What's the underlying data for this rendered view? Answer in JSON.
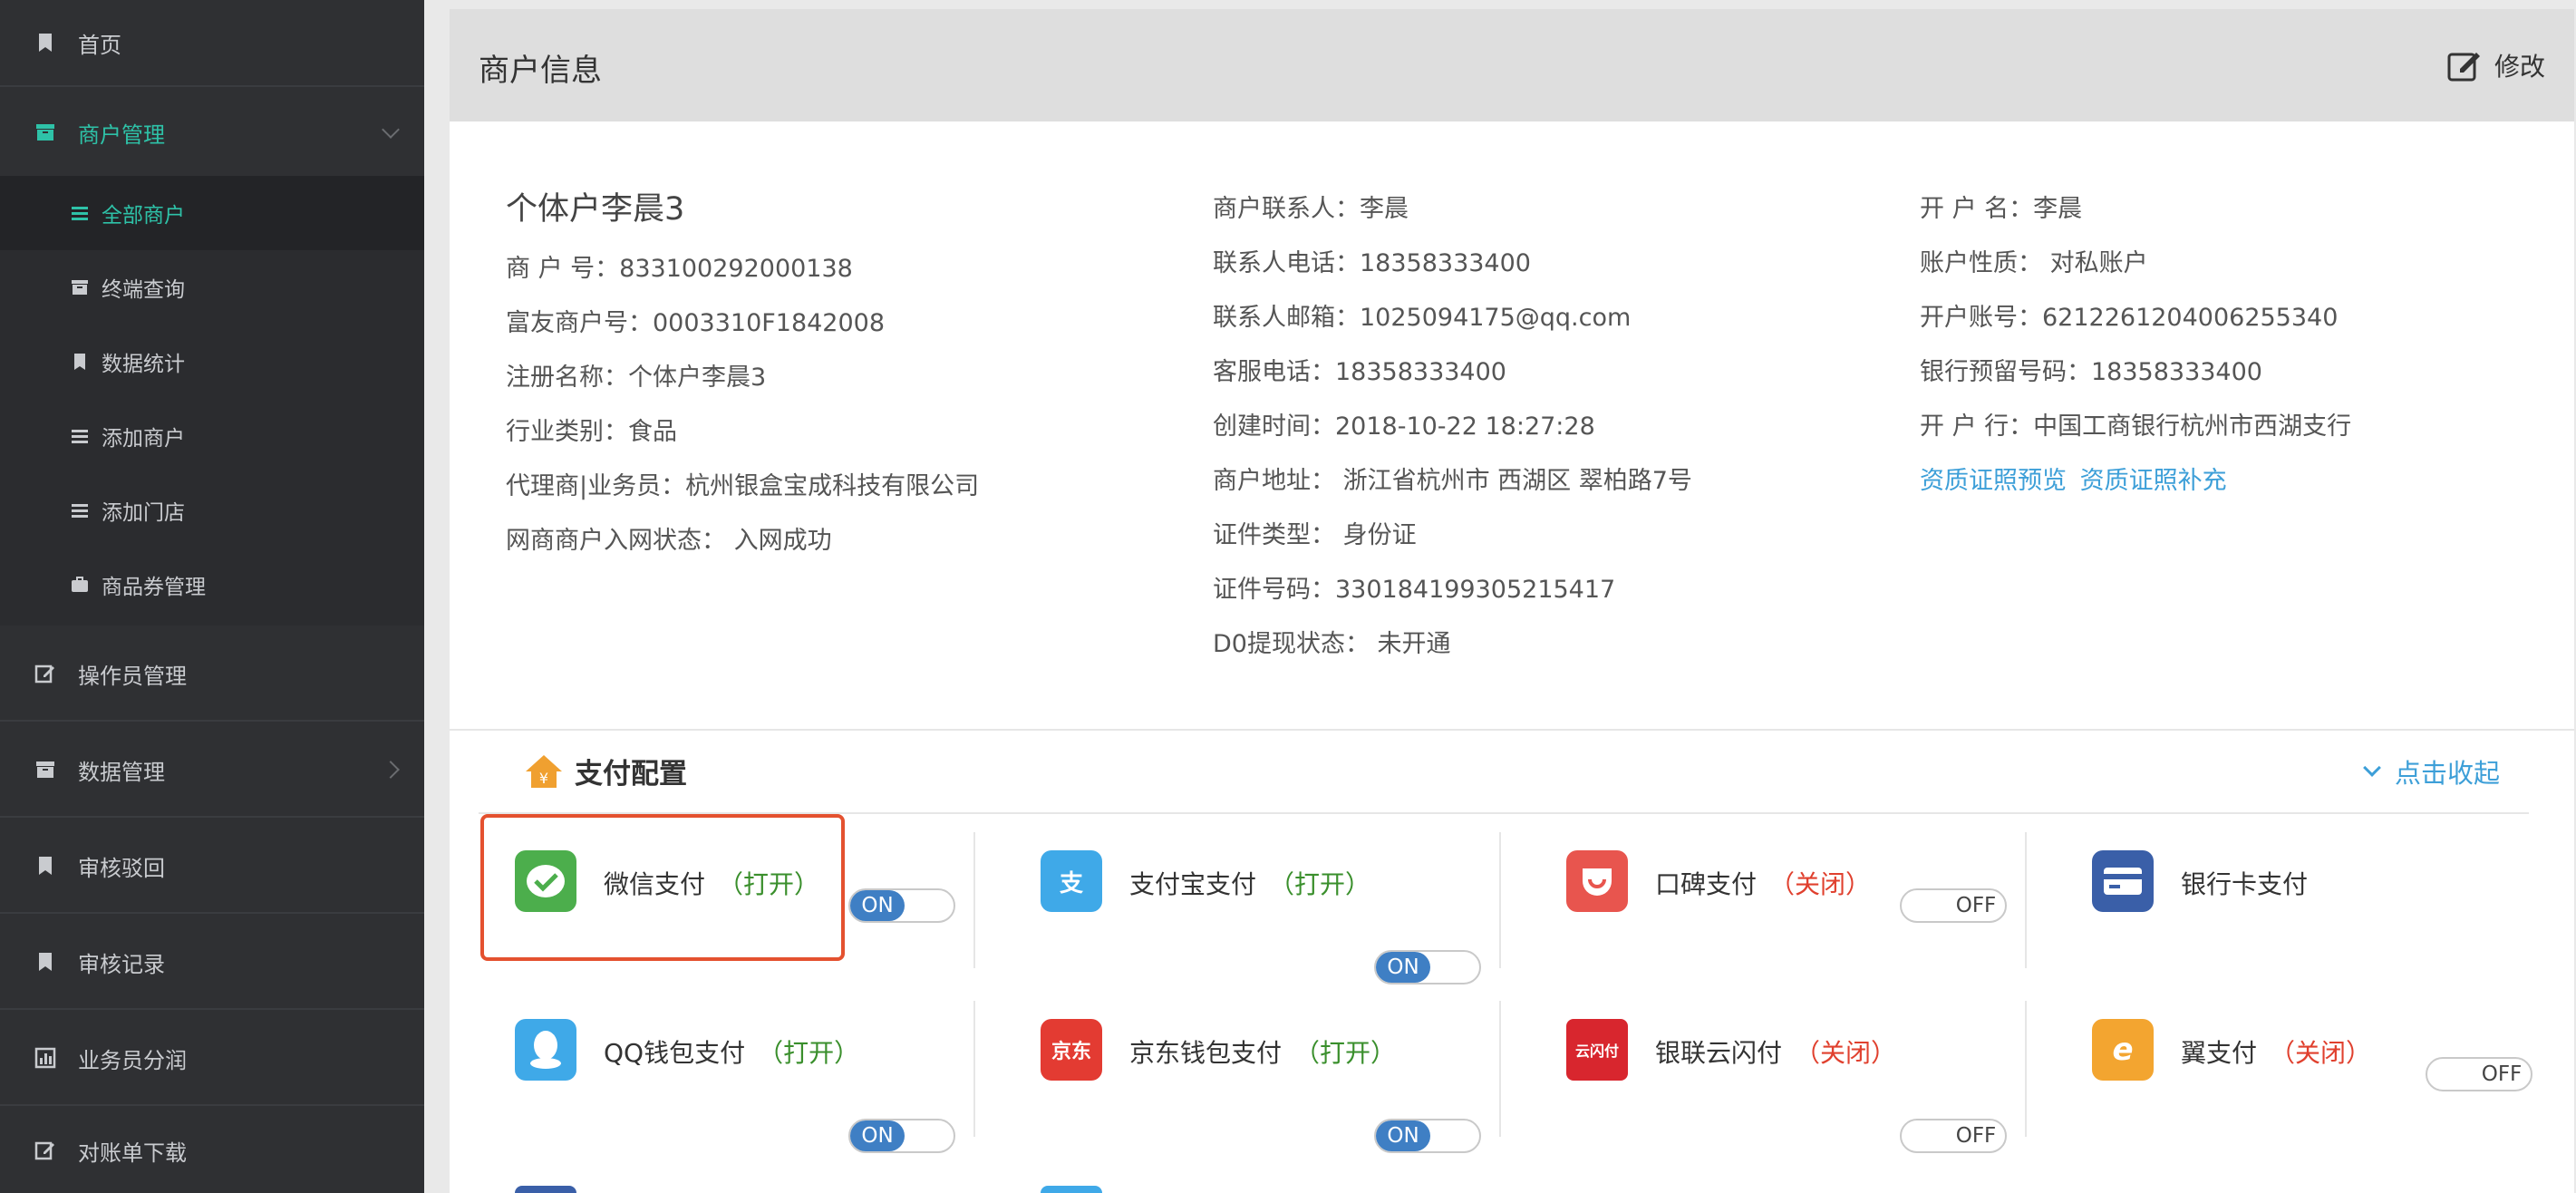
{
  "sidebar": {
    "items": [
      {
        "label": "首页",
        "icon": "bookmark-icon"
      },
      {
        "label": "商户管理",
        "icon": "archive-icon"
      },
      {
        "label": "操作员管理",
        "icon": "edit-icon"
      },
      {
        "label": "数据管理",
        "icon": "archive-icon"
      },
      {
        "label": "审核驳回",
        "icon": "bookmark-icon"
      },
      {
        "label": "审核记录",
        "icon": "bookmark-icon"
      },
      {
        "label": "业务员分润",
        "icon": "bar-chart-icon"
      },
      {
        "label": "对账单下载",
        "icon": "edit-icon"
      }
    ],
    "sub_items": [
      {
        "label": "全部商户",
        "icon": "list-icon"
      },
      {
        "label": "终端查询",
        "icon": "archive-icon"
      },
      {
        "label": "数据统计",
        "icon": "bookmark-icon"
      },
      {
        "label": "添加商户",
        "icon": "list-icon"
      },
      {
        "label": "添加门店",
        "icon": "list-icon"
      },
      {
        "label": "商品券管理",
        "icon": "briefcase-icon"
      }
    ]
  },
  "header": {
    "title": "商户信息",
    "edit_label": "修改"
  },
  "merchant": {
    "name": "个体户李晨3",
    "col1": [
      "商 户 号：833100292000138",
      "富友商户号：0003310F1842008",
      "注册名称：个体户李晨3",
      "行业类别：食品",
      "代理商|业务员：杭州银盒宝成科技有限公司",
      "网商商户入网状态：  入网成功"
    ],
    "col2": [
      "商户联系人：李晨",
      "联系人电话：18358333400",
      "联系人邮箱：1025094175@qq.com",
      "客服电话：18358333400",
      "创建时间：2018-10-22 18:27:28",
      "商户地址：  浙江省杭州市 西湖区 翠柏路7号",
      "证件类型：  身份证",
      "证件号码：330184199305215417",
      "D0提现状态：  未开通"
    ],
    "col3": [
      "开  户  名：李晨",
      "账户性质：  对私账户",
      "开户账号：6212261204006255340",
      "银行预留号码：18358333400",
      "开  户  行：中国工商银行杭州市西湖支行"
    ],
    "link_preview": "资质证照预览",
    "link_supplement": "资质证照补充"
  },
  "payment": {
    "title": "支付配置",
    "collapse_label": "点击收起",
    "methods": [
      {
        "name": "微信支付",
        "state": "（打开）",
        "toggle": "ON",
        "color": "#4cae4c",
        "glyph": "✔"
      },
      {
        "name": "支付宝支付",
        "state": "（打开）",
        "toggle": "ON",
        "color": "#3fa9e8",
        "glyph": "支"
      },
      {
        "name": "口碑支付",
        "state": "（关闭）",
        "toggle": "OFF",
        "color": "#e8554e",
        "glyph": "◡"
      },
      {
        "name": "银行卡支付",
        "state": "",
        "toggle": "",
        "color": "#3a5fa8",
        "glyph": "▭"
      },
      {
        "name": "QQ钱包支付",
        "state": "（打开）",
        "toggle": "ON",
        "color": "#3fa9e8",
        "glyph": "◉"
      },
      {
        "name": "京东钱包支付",
        "state": "（打开）",
        "toggle": "ON",
        "color": "#e33b32",
        "glyph": "京东"
      },
      {
        "name": "银联云闪付",
        "state": "（关闭）",
        "toggle": "OFF",
        "color": "#d8262e",
        "glyph": "云闪付"
      },
      {
        "name": "翼支付",
        "state": "（关闭）",
        "toggle": "OFF",
        "color": "#f3a530",
        "glyph": "e"
      }
    ]
  }
}
